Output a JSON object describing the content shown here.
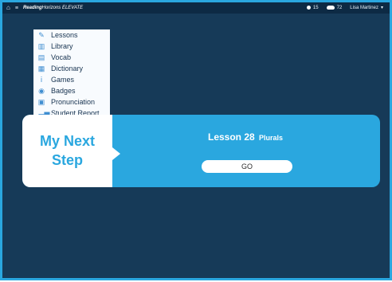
{
  "topbar": {
    "brand_bold": "Reading",
    "brand_regular": "Horizons ELEVATE",
    "stars": "15",
    "coins": "72",
    "user": "Lisa Martinez"
  },
  "menu": {
    "items": [
      {
        "label": "Lessons",
        "icon": "pencil-icon"
      },
      {
        "label": "Library",
        "icon": "library-icon"
      },
      {
        "label": "Vocab",
        "icon": "vocab-icon"
      },
      {
        "label": "Dictionary",
        "icon": "dictionary-icon"
      },
      {
        "label": "Games",
        "icon": "games-icon"
      },
      {
        "label": "Badges",
        "icon": "badge-icon"
      },
      {
        "label": "Pronunciation",
        "icon": "pronunciation-icon"
      },
      {
        "label": "Student Report",
        "icon": "report-icon"
      }
    ]
  },
  "next_step": {
    "line1": "My Next",
    "line2": "Step"
  },
  "lesson": {
    "title": "Lesson 28",
    "subtitle": "Plurals",
    "button": "GO"
  },
  "colors": {
    "accent": "#2aa7df",
    "background": "#163a58",
    "topbar": "#0d2a44"
  }
}
